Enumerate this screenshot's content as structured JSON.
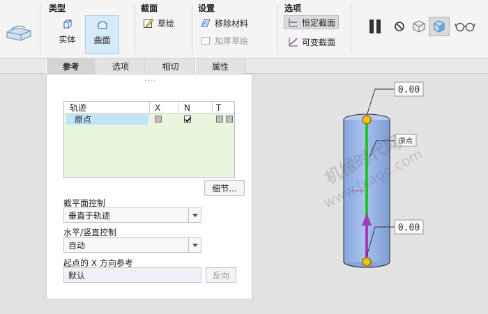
{
  "ribbon": {
    "feature_icon": "sweep-feature-icon",
    "groups": {
      "type": {
        "title": "类型",
        "solid": "实体",
        "surface": "曲面"
      },
      "section": {
        "title": "截面",
        "sketch": "草绘"
      },
      "settings": {
        "title": "设置",
        "remove_material": "移除材料",
        "thicken_sketch": "加厚草绘"
      },
      "options": {
        "title": "选项",
        "constant_section": "恒定截面",
        "variable_section": "可变截面"
      }
    },
    "tools": [
      "pause-icon",
      "no-preview-icon",
      "wireframe-preview-icon",
      "shaded-preview-icon",
      "glasses-icon"
    ]
  },
  "tabs": [
    {
      "label": "参考",
      "active": true
    },
    {
      "label": "选项",
      "active": false
    },
    {
      "label": "相切",
      "active": false
    },
    {
      "label": "属性",
      "active": false
    }
  ],
  "panel": {
    "grip": "....",
    "trajectory_table": {
      "headers": [
        "轨迹",
        "X",
        "N",
        "T"
      ],
      "rows": [
        {
          "name": "原点",
          "x": false,
          "n": true,
          "t": false
        }
      ]
    },
    "details_button": "细节...",
    "section_control_label": "截平面控制",
    "section_control_value": "垂直于轨迹",
    "orientation_label": "水平/竖直控制",
    "orientation_value": "自动",
    "x_ref_label": "起点的 X 方向参考",
    "x_ref_value": "默认",
    "flip_button": "反向"
  },
  "viewport": {
    "top_dimension": "0.00",
    "bottom_dimension": "0.00",
    "origin_label": "原点",
    "watermark_line1": "机械时代网",
    "watermark_line2": "www.jxage.com",
    "colors": {
      "cylinder": "#9fb9e6",
      "trajectory": "#22c322",
      "arrow": "#a33bb3",
      "point": "#f4c20d"
    }
  }
}
